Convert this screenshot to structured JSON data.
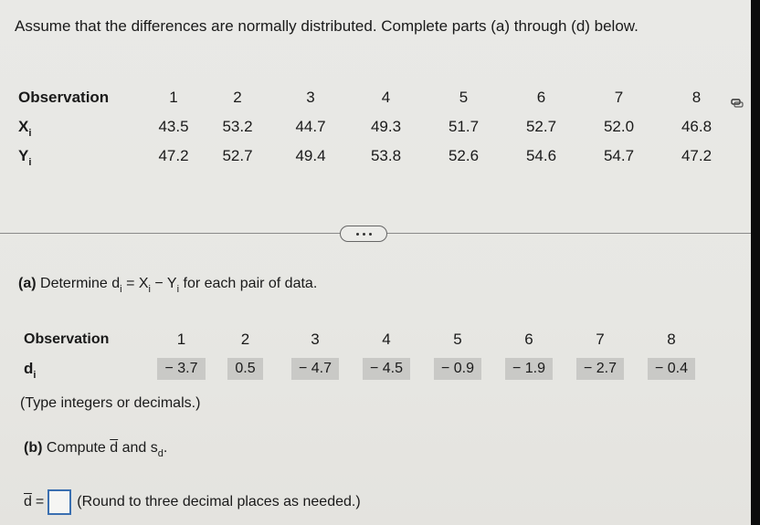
{
  "intro": "Assume that the differences are normally distributed. Complete parts (a) through (d) below.",
  "table1": {
    "header_label": "Observation",
    "observations": [
      "1",
      "2",
      "3",
      "4",
      "5",
      "6",
      "7",
      "8"
    ],
    "x_label": "X",
    "x_sub": "i",
    "x_values": [
      "43.5",
      "53.2",
      "44.7",
      "49.3",
      "51.7",
      "52.7",
      "52.0",
      "46.8"
    ],
    "y_label": "Y",
    "y_sub": "i",
    "y_values": [
      "47.2",
      "52.7",
      "49.4",
      "53.8",
      "52.6",
      "54.6",
      "54.7",
      "47.2"
    ],
    "copy_icon": "copy-icon"
  },
  "expand_icon": "more-dots-icon",
  "part_a": {
    "label": "(a)",
    "text1": "Determine d",
    "sub1": "i",
    "text2": " = X",
    "sub2": "i",
    "text3": " − Y",
    "sub3": "i",
    "text4": " for each pair of data."
  },
  "table2": {
    "header_label": "Observation",
    "observations": [
      "1",
      "2",
      "3",
      "4",
      "5",
      "6",
      "7",
      "8"
    ],
    "d_label": "d",
    "d_sub": "i",
    "d_values": [
      "− 3.7",
      "0.5",
      "− 4.7",
      "− 4.5",
      "− 0.9",
      "− 1.9",
      "− 2.7",
      "− 0.4"
    ]
  },
  "note": "(Type integers or decimals.)",
  "part_b": {
    "label": "(b)",
    "text1": "Compute ",
    "dbar": "d",
    "text2": " and s",
    "sub": "d",
    "text3": "."
  },
  "answer": {
    "var": "d",
    "eq": "=",
    "value": "",
    "hint": "(Round to three decimal places as needed.)"
  }
}
